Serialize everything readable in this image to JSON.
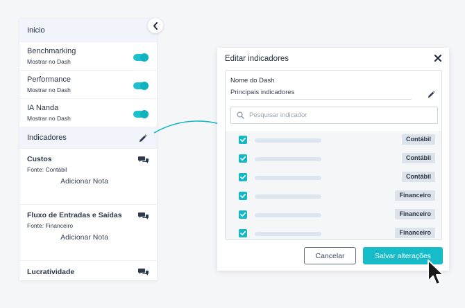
{
  "sidebar": {
    "inicio": "Inicio",
    "toggle_items": [
      {
        "title": "Benchmarking",
        "subtitle": "Mostrar no Dash",
        "enabled": true
      },
      {
        "title": "Performance",
        "subtitle": "Mostrar no Dash",
        "enabled": true
      },
      {
        "title": "IA Nanda",
        "subtitle": "Mostrar no Dash",
        "enabled": true
      }
    ],
    "indicadores": "Indicadores",
    "note_blocks": [
      {
        "title": "Custos",
        "subtitle": "Fonte: Contábil",
        "add_note": "Adicionar Nota"
      },
      {
        "title": "Fluxo de Entradas e Saídas",
        "subtitle": "Fonte: Financeiro",
        "add_note": "Adicionar Nota"
      }
    ],
    "last_item": "Lucratividade"
  },
  "modal": {
    "title": "Editar indicadores",
    "dash_name_label": "Nome do Dash",
    "dash_name_value": "Principais indicadores",
    "search_placeholder": "Pesquisar indicador",
    "indicators": [
      {
        "checked": true,
        "tag": "Contábil"
      },
      {
        "checked": true,
        "tag": "Contábil"
      },
      {
        "checked": true,
        "tag": "Contábil"
      },
      {
        "checked": true,
        "tag": "Financeiro"
      },
      {
        "checked": true,
        "tag": "Financeiro"
      },
      {
        "checked": true,
        "tag": "Financeiro"
      }
    ],
    "cancel_label": "Cancelar",
    "save_label": "Salvar alterações"
  },
  "colors": {
    "accent": "#16bcc8",
    "toggle_on": "#1ec0cc",
    "tag_bg": "#dde3ea"
  }
}
